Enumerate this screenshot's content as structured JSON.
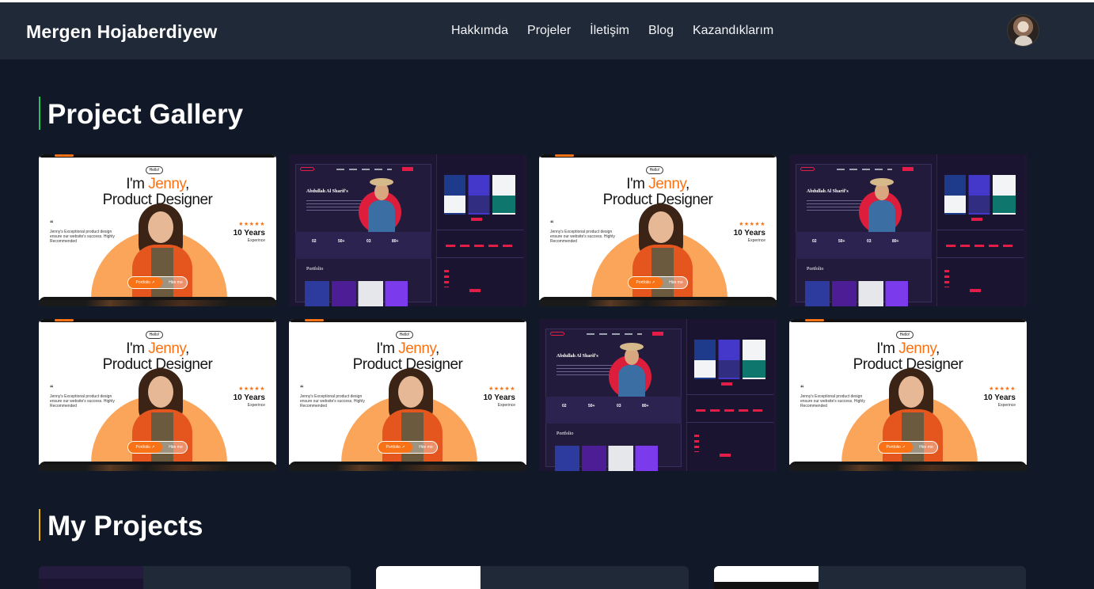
{
  "header": {
    "brand": "Mergen Hojaberdiyew",
    "nav": [
      "Hakkımda",
      "Projeler",
      "İletişim",
      "Blog",
      "Kazandıklarım"
    ]
  },
  "sections": {
    "gallery_title": "Project Gallery",
    "projects_title": "My Projects"
  },
  "mock_light": {
    "hello": "Hello!",
    "line1_pre": "I'm ",
    "line1_accent": "Jenny",
    "line1_post": ",",
    "line2": "Product Designer",
    "quote": "“",
    "description": "Jenny's Exceptional product design ensure our website's success. Highly Recommended",
    "stars": "★★★★★",
    "years": "10 Years",
    "experience": "Experince",
    "portfolio_btn": "Portfolio ↗",
    "hire_btn": "Hire me"
  },
  "mock_dark": {
    "name": "Abdullah Al Sharif's",
    "stats": [
      "02",
      "50+",
      "03",
      "80+"
    ],
    "portfolio": "Portfolio"
  },
  "colors": {
    "page_bg": "#111827",
    "navbar_bg": "#1f2937",
    "gallery_accent": "#22c55e",
    "projects_accent": "#eab308",
    "mock_orange": "#f97316"
  }
}
